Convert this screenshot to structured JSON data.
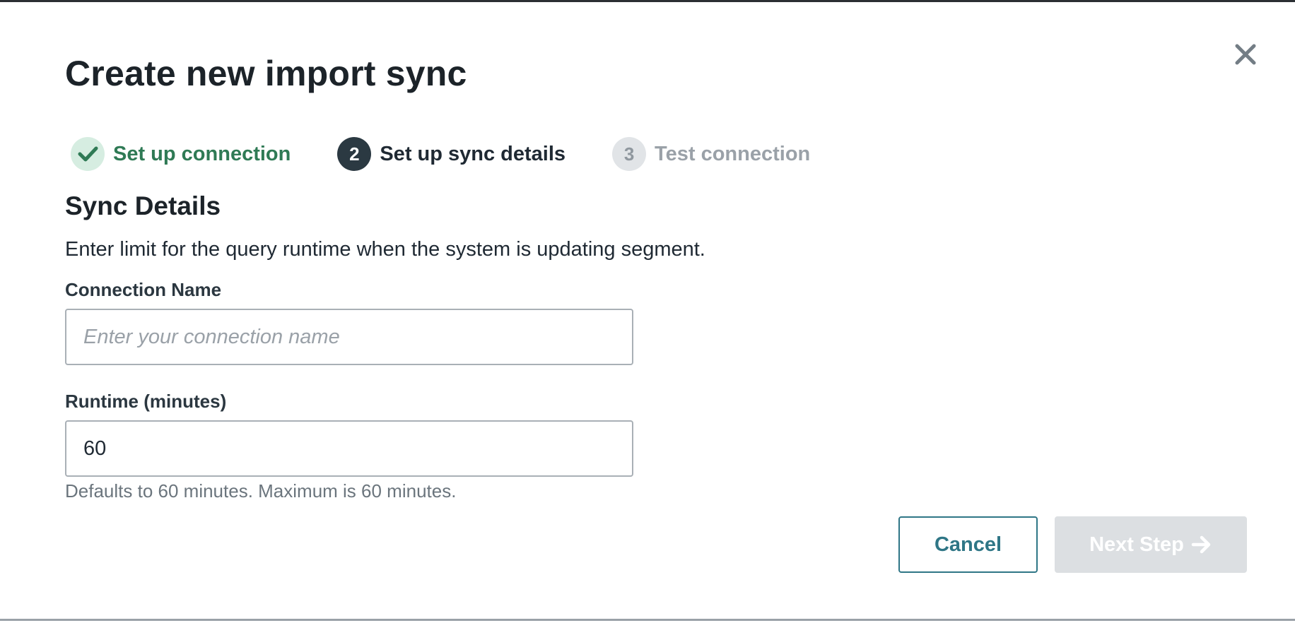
{
  "dialog": {
    "title": "Create new import sync",
    "close_icon": "close-icon"
  },
  "stepper": {
    "steps": [
      {
        "marker": "check-icon",
        "label": "Set up connection",
        "state": "done"
      },
      {
        "marker": "2",
        "label": "Set up sync details",
        "state": "active"
      },
      {
        "marker": "3",
        "label": "Test connection",
        "state": "pending"
      }
    ]
  },
  "section": {
    "title": "Sync Details",
    "description": "Enter limit for the query runtime when the system is updating segment."
  },
  "form": {
    "connection_name": {
      "label": "Connection Name",
      "value": "",
      "placeholder": "Enter your connection name"
    },
    "runtime": {
      "label": "Runtime (minutes)",
      "value": "60",
      "help": "Defaults to 60 minutes. Maximum is 60 minutes."
    }
  },
  "actions": {
    "cancel_label": "Cancel",
    "next_label": "Next Step",
    "next_icon": "arrow-right-icon",
    "next_disabled": true
  },
  "colors": {
    "success": "#2f7a55",
    "success_bg": "#d6ede1",
    "active_step": "#2b3942",
    "primary_outline": "#2f7686",
    "disabled_button": "#dcdfe2"
  }
}
